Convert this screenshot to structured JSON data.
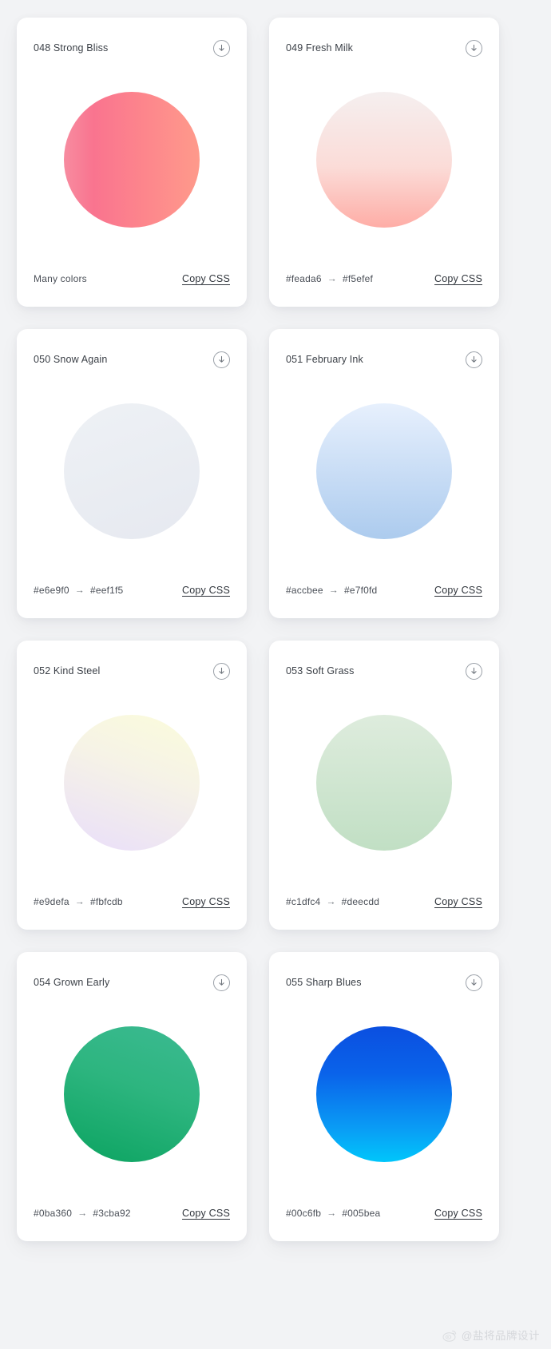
{
  "page": {
    "background": "#f2f3f5",
    "card_background": "#ffffff"
  },
  "labels": {
    "copy_css": "Copy CSS",
    "arrow": "→",
    "download_icon": "download-circle-icon"
  },
  "cards": [
    {
      "title": "048 Strong Bliss",
      "from": "#f78ca0",
      "to": "#fe9a8b",
      "gradient": "linear-gradient(90deg, #f78ca0 0%, #f9748f 22%, #fd868c 60%, #fe9a8b 100%)",
      "footer_text": "Many colors",
      "show_hexes": false,
      "copy_label": "Copy CSS"
    },
    {
      "title": "049 Fresh Milk",
      "from": "#feada6",
      "to": "#f5efef",
      "gradient": "linear-gradient(180deg, #f5efef 0%, #fbdcd8 55%, #feada6 100%)",
      "footer_text": "",
      "show_hexes": true,
      "copy_label": "Copy CSS"
    },
    {
      "title": "050 Snow Again",
      "from": "#e6e9f0",
      "to": "#eef1f5",
      "gradient": "linear-gradient(160deg, #eef1f5 0%, #e6e9f0 100%)",
      "footer_text": "",
      "show_hexes": true,
      "copy_label": "Copy CSS"
    },
    {
      "title": "051 February Ink",
      "from": "#accbee",
      "to": "#e7f0fd",
      "gradient": "linear-gradient(180deg, #e7f0fd 0%, #accbee 100%)",
      "footer_text": "",
      "show_hexes": true,
      "copy_label": "Copy CSS"
    },
    {
      "title": "052 Kind Steel",
      "from": "#e9defa",
      "to": "#fbfcdb",
      "gradient": "linear-gradient(200deg, #fbfcdb 0%, #f6f3e6 40%, #e9defa 100%)",
      "footer_text": "",
      "show_hexes": true,
      "copy_label": "Copy CSS"
    },
    {
      "title": "053 Soft Grass",
      "from": "#c1dfc4",
      "to": "#deecdd",
      "gradient": "linear-gradient(180deg, #deecdd 0%, #c1dfc4 100%)",
      "footer_text": "",
      "show_hexes": true,
      "copy_label": "Copy CSS"
    },
    {
      "title": "054 Grown Early",
      "from": "#0ba360",
      "to": "#3cba92",
      "gradient": "linear-gradient(200deg, #3cba92 0%, #2db57f 45%, #0ba360 100%)",
      "footer_text": "",
      "show_hexes": true,
      "copy_label": "Copy CSS"
    },
    {
      "title": "055 Sharp Blues",
      "from": "#00c6fb",
      "to": "#005bea",
      "gradient": "linear-gradient(180deg, #0b4fe0 0%, #0a63ea 35%, #0a9cf5 75%, #00c6fb 100%)",
      "footer_text": "",
      "show_hexes": true,
      "copy_label": "Copy CSS"
    }
  ],
  "watermark": {
    "text": "@盐将品牌设计",
    "logo": "weibo-eye-icon"
  }
}
